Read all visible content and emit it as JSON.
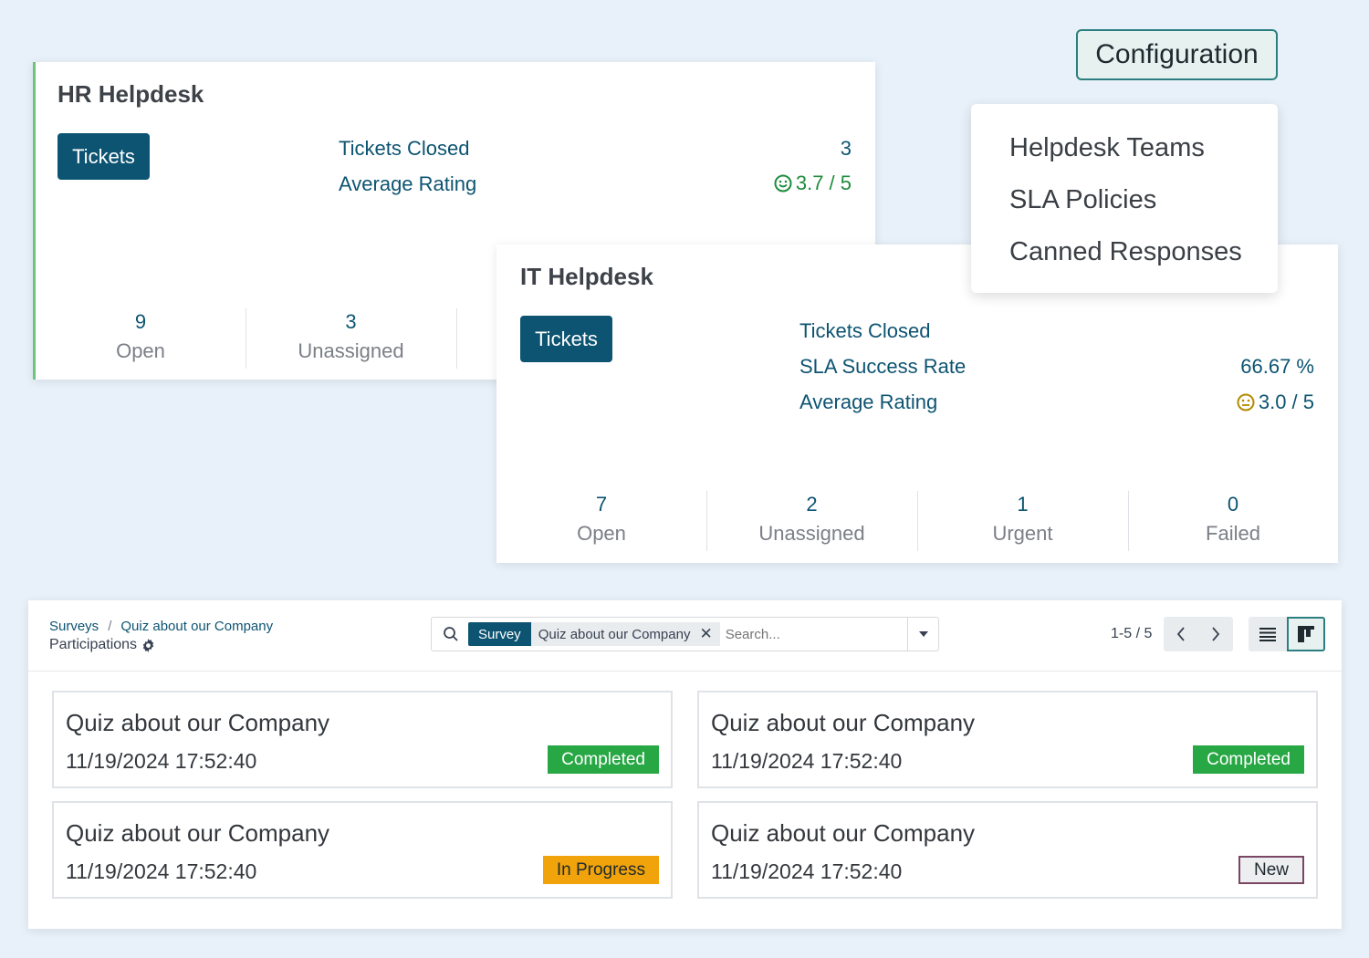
{
  "hr_card": {
    "title": "HR Helpdesk",
    "tickets_label": "Tickets",
    "kpis": [
      {
        "label": "Tickets Closed",
        "value": "3"
      },
      {
        "label": "Average Rating",
        "value": "3.7 / 5",
        "icon": "smiley-happy-icon"
      }
    ],
    "stats": [
      {
        "num": "9",
        "label": "Open"
      },
      {
        "num": "3",
        "label": "Unassigned"
      }
    ]
  },
  "it_card": {
    "title": "IT Helpdesk",
    "tickets_label": "Tickets",
    "kpis": [
      {
        "label": "Tickets Closed",
        "value": ""
      },
      {
        "label": "SLA Success Rate",
        "value": "66.67 %"
      },
      {
        "label": "Average Rating",
        "value": "3.0 / 5",
        "icon": "smiley-neutral-icon"
      }
    ],
    "stats": [
      {
        "num": "7",
        "label": "Open"
      },
      {
        "num": "2",
        "label": "Unassigned"
      },
      {
        "num": "1",
        "label": "Urgent"
      },
      {
        "num": "0",
        "label": "Failed"
      }
    ]
  },
  "configuration": {
    "button_label": "Configuration",
    "menu": [
      "Helpdesk Teams",
      "SLA Policies",
      "Canned Responses"
    ]
  },
  "surveys": {
    "breadcrumb": [
      "Surveys",
      "Quiz about our Company"
    ],
    "breadcrumb_sep": "/",
    "subtitle": "Participations",
    "search": {
      "facet_label": "Survey",
      "facet_value": "Quiz about our Company",
      "placeholder": "Search..."
    },
    "pager": "1-5 / 5",
    "cards": [
      {
        "title": "Quiz about our Company",
        "date": "11/19/2024 17:52:40",
        "status": "Completed"
      },
      {
        "title": "Quiz about our Company",
        "date": "11/19/2024 17:52:40",
        "status": "Completed"
      },
      {
        "title": "Quiz about our Company",
        "date": "11/19/2024 17:52:40",
        "status": "In Progress"
      },
      {
        "title": "Quiz about our Company",
        "date": "11/19/2024 17:52:40",
        "status": "New"
      }
    ]
  },
  "colors": {
    "primary": "#0d5472",
    "accent": "#2c7f80",
    "completed": "#28a745",
    "in_progress": "#f0a30a",
    "new_border": "#7a4664",
    "background": "#e8f1fa"
  }
}
